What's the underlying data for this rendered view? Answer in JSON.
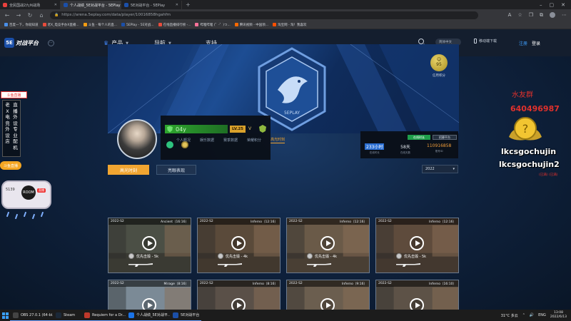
{
  "browser": {
    "tabs": [
      {
        "title": "全民国战2九州战场",
        "active": false
      },
      {
        "title": "个人战绩_5E对战平台 - 5EPlay",
        "active": true
      },
      {
        "title": "5E对战平台 - 5EPlay",
        "active": false
      }
    ],
    "url": "https://arena.5eplay.com/data/player/10016858hgahfm",
    "bookmarks": [
      "百度一下，你就知道",
      "老X_电竞手办X直播...",
      "斗鱼 - 每个人的直...",
      "5EPlay - 5E对战...",
      "在线直播排行榜 -...",
      "哔哩哔哩 (゜-゜)つ...",
      "腾讯视频 - 中国领...",
      "淘宝网 - 淘！我喜欢"
    ]
  },
  "site_nav": {
    "logo_badge": "5E",
    "logo_text": "对战平台",
    "menu": [
      "产品",
      "导航",
      "支持"
    ],
    "lang_label": "简体中文",
    "mobile_label": "移动端下载",
    "register": "注册",
    "login": "登录"
  },
  "banner": {
    "emblem_text": "5EPLAY",
    "credit_score": "95",
    "credit_label": "信用积分"
  },
  "player": {
    "name": "04y",
    "level": "LV.25",
    "level_suffix": "V"
  },
  "stats": {
    "tag_green": "在线时长",
    "tag_dark": "招募平台",
    "items": [
      {
        "value": "233小时",
        "label": "在线时长"
      },
      {
        "value": "58天",
        "label": "在线天数"
      },
      {
        "value": "110916858",
        "label": "账号ID"
      }
    ]
  },
  "subtabs": [
    "个人概况",
    "娱乐数据",
    "赛季数据",
    "荣耀积分",
    "高光时刻"
  ],
  "filters": {
    "primary": "高光时刻",
    "secondary": "亮眼表现",
    "year": "2022"
  },
  "cards": [
    {
      "season": "2022-S2",
      "map": "Ancient（16:16）",
      "desc": "优先击毁 - 5k"
    },
    {
      "season": "2022-S2",
      "map": "Inferno（12:16）",
      "desc": "优先击毁 - 4k"
    },
    {
      "season": "2022-S2",
      "map": "Inferno（12:16）",
      "desc": "优先击毁 - 4k"
    },
    {
      "season": "2022-S2",
      "map": "Inferno（12:16）",
      "desc": "优先击毁 - 5k"
    },
    {
      "season": "2022-S2",
      "map": "Mirage（8:16）",
      "desc": ""
    },
    {
      "season": "2022-S2",
      "map": "Inferno（8:16）",
      "desc": ""
    },
    {
      "season": "2022-S2",
      "map": "Inferno（9:16）",
      "desc": ""
    },
    {
      "season": "2022-S2",
      "map": "Inferno（16:10）",
      "desc": ""
    }
  ],
  "stream_overlay": {
    "left_label": "斗鱼直播",
    "left_vertical_1": "老X电竞外设店",
    "left_vertical_2": "直播外设专业配机",
    "left_bubble": "斗鱼直播",
    "left_card_label": "5139",
    "left_card_circle": "ROOM",
    "left_card_tag": "直播",
    "right_line1": "水友群",
    "right_line2": "640496987",
    "right_line3": "lkcsgochujin",
    "right_line4": "lkcsgochujin2",
    "right_line5": "(已满) (已满)"
  },
  "taskbar": {
    "tasks": [
      {
        "label": "OBS 27.0.1 (64-bi...",
        "color": "#444"
      },
      {
        "label": "Steam",
        "color": "#1b2838"
      },
      {
        "label": "Requiem for a Dr...",
        "color": "#c0392b"
      },
      {
        "label": "个人战绩_5E对战平...",
        "color": "#1a73e8"
      },
      {
        "label": "5E对战平台",
        "color": "#1b4fa8"
      }
    ],
    "weather": "31°C 多云",
    "lang": "ENG",
    "time": "13:08",
    "date": "2022/6/13"
  }
}
